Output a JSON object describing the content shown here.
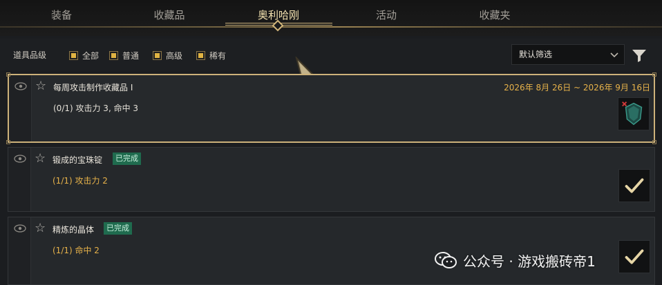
{
  "tabs": [
    {
      "label": "装备",
      "active": false
    },
    {
      "label": "收藏品",
      "active": false
    },
    {
      "label": "奥利哈刚",
      "active": true
    },
    {
      "label": "活动",
      "active": false
    },
    {
      "label": "收藏夹",
      "active": false
    }
  ],
  "filter": {
    "label": "道具品级",
    "options": [
      "全部",
      "普通",
      "高级",
      "稀有"
    ],
    "dropdown_value": "默认筛选",
    "accent_color": "#e0b342"
  },
  "items": [
    {
      "title": "每周攻击制作收藏品 I",
      "badge": "",
      "description": "(0/1) 攻击力 3, 命中 3",
      "date": "2026年 8月 26日 ~ 2026年 9月 16日",
      "thumb_icon": "crystal-shield-icon",
      "completed": false
    },
    {
      "title": "锻成的宝珠锭",
      "badge": "已完成",
      "description": "(1/1) 攻击力 2",
      "thumb_icon": "checkmark-icon",
      "completed": true
    },
    {
      "title": "精炼的晶体",
      "badge": "已完成",
      "description": "(1/1) 命中 2",
      "thumb_icon": "checkmark-icon",
      "completed": true
    }
  ],
  "watermark": {
    "text": "公众号 · 游戏搬砖帝1"
  },
  "colors": {
    "gold_text": "#e7b24a",
    "badge_green": "#1f6b4e",
    "selected_border": "#cdb27a"
  }
}
